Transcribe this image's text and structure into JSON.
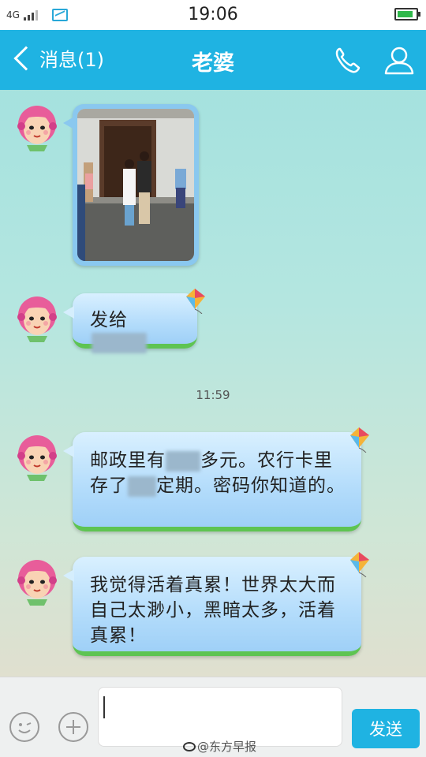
{
  "status_bar": {
    "network": "4G",
    "time": "19:06",
    "battery_level": 0.85
  },
  "header": {
    "back_label": "消息(1)",
    "title": "老婆"
  },
  "messages": [
    {
      "type": "image"
    },
    {
      "type": "text",
      "parts": [
        "发给"
      ]
    },
    {
      "type": "timestamp",
      "text": "11:59"
    },
    {
      "type": "text",
      "parts": [
        "邮政里有",
        "多元。农行卡里存了",
        "定期。密码你知道的。"
      ]
    },
    {
      "type": "text",
      "text": "我觉得活着真累！世界太大而自己太渺小，黑暗太多，活着真累！"
    }
  ],
  "input": {
    "value": "",
    "send_label": "发送"
  },
  "watermark": "@东方早报",
  "colors": {
    "accent": "#1fb3e2",
    "bubble": "#b3dcfb",
    "bubble_grass": "#5ec452"
  }
}
